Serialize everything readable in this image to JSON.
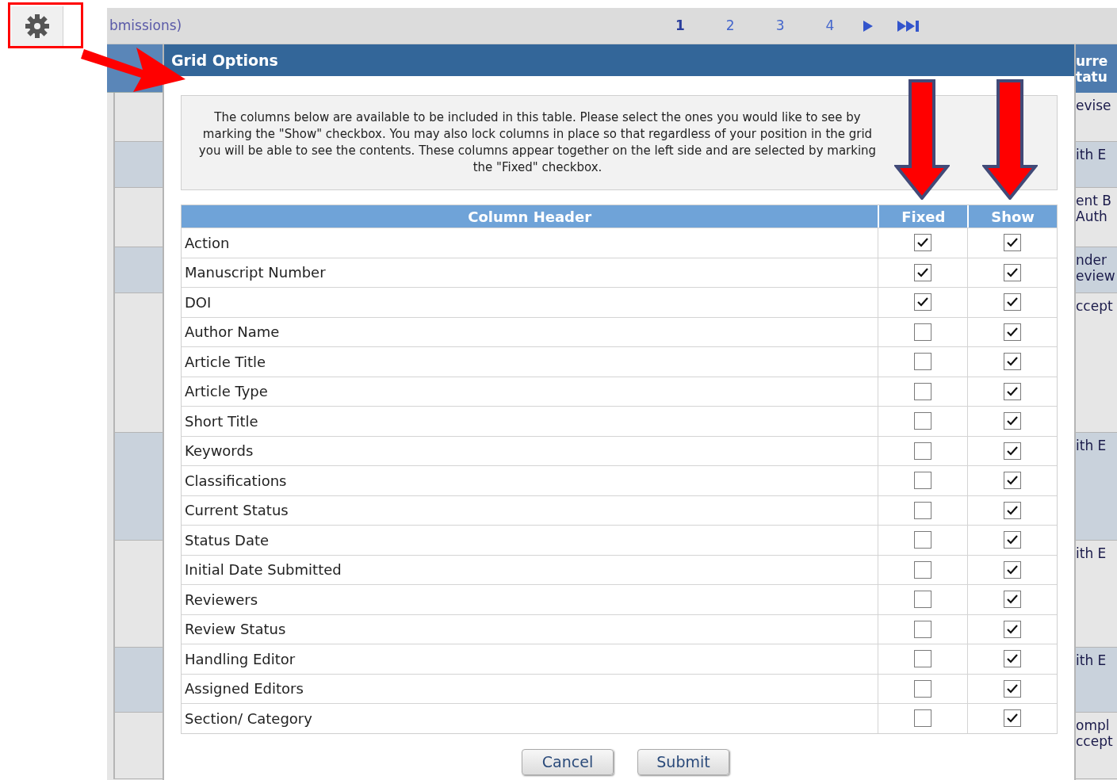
{
  "top_bar": {
    "title": "bmissions)",
    "pages": [
      {
        "label": "1",
        "selected": true
      },
      {
        "label": "2",
        "selected": false
      },
      {
        "label": "3",
        "selected": false
      },
      {
        "label": "4",
        "selected": false
      }
    ]
  },
  "right_column": {
    "header": [
      "urre",
      "tatu"
    ],
    "rows": [
      {
        "lines": [
          "evise"
        ],
        "shaded": false
      },
      {
        "lines": [
          "ith E"
        ],
        "shaded": true
      },
      {
        "lines": [
          "ent B",
          "Auth"
        ],
        "shaded": false
      },
      {
        "lines": [
          "nder",
          "eview"
        ],
        "shaded": true
      },
      {
        "lines": [
          "ccept"
        ],
        "shaded": false
      },
      {
        "lines": [
          "ith E"
        ],
        "shaded": true
      },
      {
        "lines": [
          "ith E"
        ],
        "shaded": false
      },
      {
        "lines": [
          "ith E"
        ],
        "shaded": true
      },
      {
        "lines": [
          "ompl",
          "ccept"
        ],
        "shaded": false
      }
    ]
  },
  "dialog": {
    "title": "Grid Options",
    "description": "The columns below are available to be included in this table. Please select the ones you would like to see by marking the \"Show\" checkbox. You may also lock columns in place so that regardless of your position in the grid you will be able to see the contents. These columns appear together on the left side and are selected by marking the \"Fixed\" checkbox.",
    "columns": [
      "Column Header",
      "Fixed",
      "Show"
    ],
    "rows": [
      {
        "label": "Action",
        "fixed": true,
        "show": true
      },
      {
        "label": "Manuscript Number",
        "fixed": true,
        "show": true
      },
      {
        "label": "DOI",
        "fixed": true,
        "show": true
      },
      {
        "label": "Author Name",
        "fixed": false,
        "show": true
      },
      {
        "label": "Article Title",
        "fixed": false,
        "show": true
      },
      {
        "label": "Article Type",
        "fixed": false,
        "show": true
      },
      {
        "label": "Short Title",
        "fixed": false,
        "show": true
      },
      {
        "label": "Keywords",
        "fixed": false,
        "show": true
      },
      {
        "label": "Classifications",
        "fixed": false,
        "show": true
      },
      {
        "label": "Current Status",
        "fixed": false,
        "show": true
      },
      {
        "label": "Status Date",
        "fixed": false,
        "show": true
      },
      {
        "label": "Initial Date Submitted",
        "fixed": false,
        "show": true
      },
      {
        "label": "Reviewers",
        "fixed": false,
        "show": true
      },
      {
        "label": "Review Status",
        "fixed": false,
        "show": true
      },
      {
        "label": "Handling Editor",
        "fixed": false,
        "show": true
      },
      {
        "label": "Assigned Editors",
        "fixed": false,
        "show": true
      },
      {
        "label": "Section/ Category",
        "fixed": false,
        "show": true
      }
    ],
    "buttons": [
      "Cancel",
      "Submit"
    ]
  }
}
